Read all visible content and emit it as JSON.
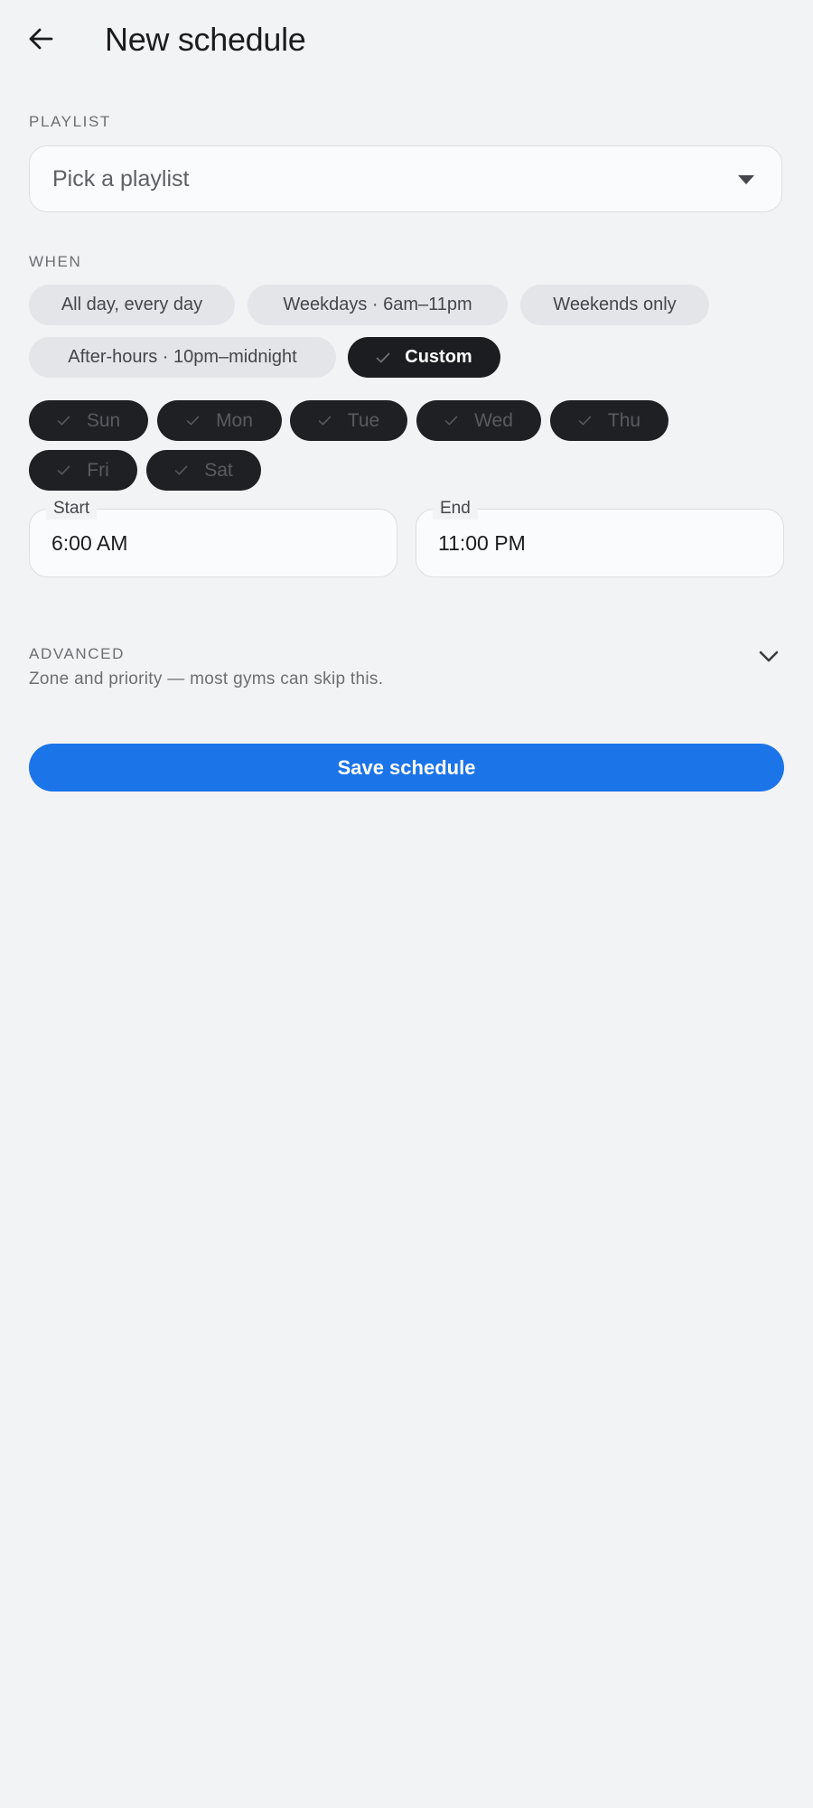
{
  "header": {
    "back_icon": "arrow-left-icon",
    "title": "New schedule"
  },
  "playlist": {
    "label": "PLAYLIST",
    "placeholder": "Pick a playlist",
    "caret_icon": "caret-down-icon"
  },
  "when": {
    "label": "WHEN",
    "presets": [
      {
        "label": "All day, every day",
        "selected": false
      },
      {
        "label": "Weekdays · 6am–11pm",
        "selected": false
      },
      {
        "label": "Weekends only",
        "selected": false
      },
      {
        "label": "After-hours · 10pm–midnight",
        "selected": false
      },
      {
        "label": "Custom",
        "selected": true
      }
    ],
    "days": [
      {
        "label": "Sun",
        "checked": true
      },
      {
        "label": "Mon",
        "checked": true
      },
      {
        "label": "Tue",
        "checked": true
      },
      {
        "label": "Wed",
        "checked": true
      },
      {
        "label": "Thu",
        "checked": true
      },
      {
        "label": "Fri",
        "checked": true
      },
      {
        "label": "Sat",
        "checked": true
      }
    ],
    "start": {
      "label": "Start",
      "value": "6:00 AM"
    },
    "end": {
      "label": "End",
      "value": "11:00 PM"
    }
  },
  "advanced": {
    "title": "ADVANCED",
    "subtitle": "Zone and priority — most gyms can skip this.",
    "chevron_icon": "chevron-down-icon"
  },
  "actions": {
    "save_label": "Save schedule"
  },
  "colors": {
    "background": "#f2f3f5",
    "primary": "#1b74e8",
    "chip_selected": "#1c1d20",
    "chip_default": "#e4e5e8"
  }
}
